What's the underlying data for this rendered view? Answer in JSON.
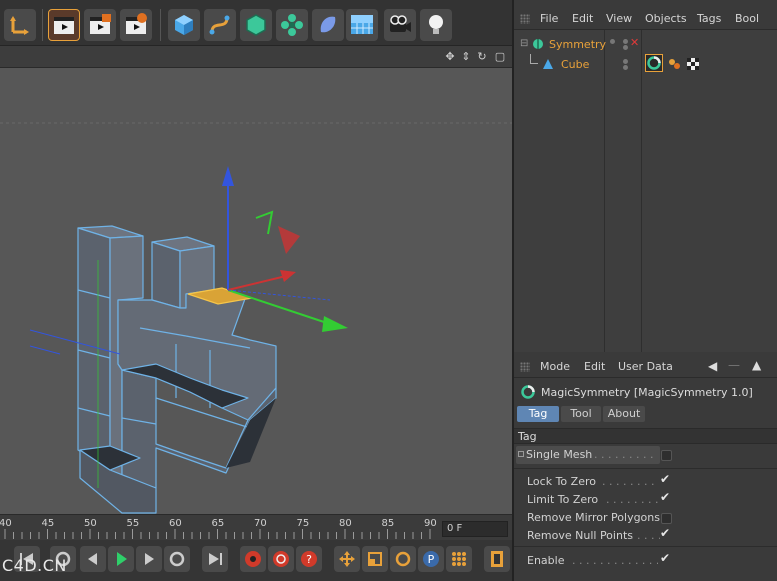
{
  "watermark": "C4D.CN",
  "toolbar": {
    "buttons": [
      {
        "name": "move-tool-icon"
      },
      {
        "name": "cube-object-icon"
      },
      {
        "name": "render-view-icon"
      },
      {
        "name": "render-picture-viewer-icon"
      },
      {
        "name": "render-settings-icon"
      },
      {
        "name": "cube-primitive-icon"
      },
      {
        "name": "spline-icon"
      },
      {
        "name": "subdivision-surface-icon"
      },
      {
        "name": "cloner-icon"
      },
      {
        "name": "deformer-icon"
      },
      {
        "name": "floor-scene-icon"
      },
      {
        "name": "camera-icon"
      },
      {
        "name": "light-icon"
      }
    ]
  },
  "timeline": {
    "ticks": [
      "40",
      "45",
      "50",
      "55",
      "60",
      "65",
      "70",
      "75",
      "80",
      "85",
      "90"
    ],
    "current_frame": "0 F"
  },
  "object_manager": {
    "menu": [
      "File",
      "Edit",
      "View",
      "Objects",
      "Tags",
      "Bool"
    ],
    "objects": [
      {
        "name": "Symmetry",
        "color": "#e8a13a"
      },
      {
        "name": "Cube",
        "color": "#e8a13a"
      }
    ]
  },
  "attribute_manager": {
    "menu": [
      "Mode",
      "Edit",
      "User Data"
    ],
    "title": "MagicSymmetry [MagicSymmetry 1.0]",
    "tabs": [
      "Tag",
      "Tool",
      "About"
    ],
    "active_tab": "Tag",
    "section": "Tag",
    "single_mesh": {
      "label": "Single Mesh",
      "dots": ". . . . . . . . . . . .",
      "checked": false
    },
    "options": [
      {
        "label": "Lock To Zero",
        "dots": ". . . . . . . . . . .",
        "checked": true
      },
      {
        "label": "Limit To Zero",
        "dots": ". . . . . . . . . . .",
        "checked": true
      },
      {
        "label": "Remove Mirror Polygons",
        "dots": "",
        "checked": false
      },
      {
        "label": "Remove Null Points",
        "dots": ". . . . .",
        "checked": true
      }
    ],
    "enable": {
      "label": "Enable",
      "dots": ". . . . . . . . . . . . . . . . .",
      "checked": true
    }
  },
  "colors": {
    "accent_orange": "#e8a13a",
    "active_tab": "#5f86b4",
    "axis_x": "#33cc33",
    "axis_y": "#3355dd",
    "axis_z": "#cc3333",
    "viewport_bg": "#575757"
  }
}
